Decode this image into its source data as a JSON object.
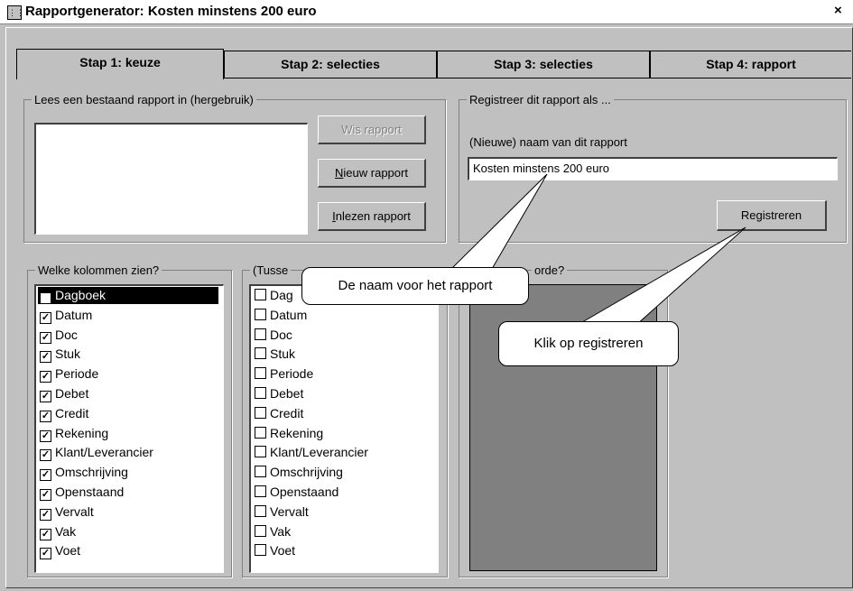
{
  "window": {
    "title": "Rapportgenerator: Kosten minstens 200 euro",
    "close": "×"
  },
  "tabs": [
    "Stap 1: keuze",
    "Stap 2: selecties",
    "Stap 3: selecties",
    "Stap 4: rapport"
  ],
  "reuse": {
    "legend": "Lees een bestaand rapport in (hergebruik)",
    "delete_label": "Wis rapport",
    "new_label_u": "N",
    "new_label_rest": "ieuw rapport",
    "load_label_u": "I",
    "load_label_rest": "nlezen rapport"
  },
  "register": {
    "legend": "Registreer dit rapport als ...",
    "name_label": "(Nieuwe) naam van dit rapport",
    "name_value": "Kosten minstens 200 euro",
    "register_label": "Registreren"
  },
  "columns": {
    "legend": "Welke kolommen zien?",
    "items": [
      "Dagboek",
      "Datum",
      "Doc",
      "Stuk",
      "Periode",
      "Debet",
      "Credit",
      "Rekening",
      "Klant/Leverancier",
      "Omschrijving",
      "Openstaand",
      "Vervalt",
      "Vak",
      "Voet"
    ]
  },
  "subtotals": {
    "legend": "(Tusse",
    "items": [
      "Dag",
      "Datum",
      "Doc",
      "Stuk",
      "Periode",
      "Debet",
      "Credit",
      "Rekening",
      "Klant/Leverancier",
      "Omschrijving",
      "Openstaand",
      "Vervalt",
      "Vak",
      "Voet"
    ]
  },
  "order": {
    "legend": "orde?"
  },
  "callouts": {
    "name": "De naam voor het rapport",
    "register": "Klik op registreren"
  }
}
